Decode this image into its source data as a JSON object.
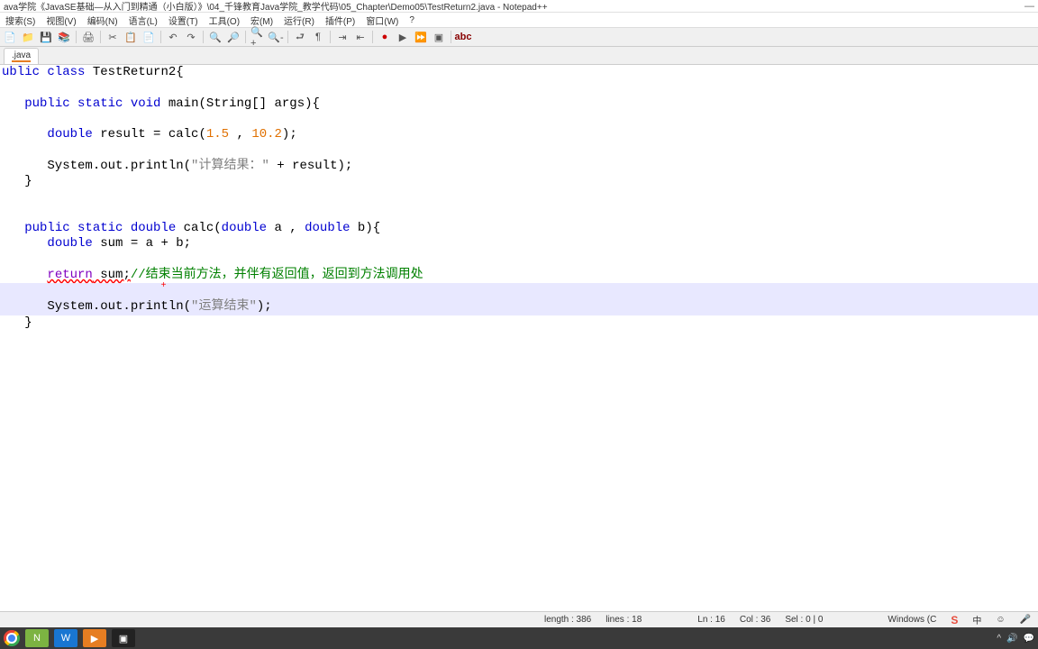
{
  "window": {
    "title": "ava学院《JavaSE基础—从入门到精通（小白版）》\\04_千锋教育Java学院_教学代码\\05_Chapter\\Demo05\\TestReturn2.java - Notepad++"
  },
  "menu": {
    "items": [
      "搜索(S)",
      "视图(V)",
      "编码(N)",
      "语言(L)",
      "设置(T)",
      "工具(O)",
      "宏(M)",
      "运行(R)",
      "插件(P)",
      "窗口(W)",
      "?"
    ]
  },
  "tab": {
    "label": ".java"
  },
  "code": {
    "l1_pre": "ublic class ",
    "l1_name": "TestReturn2",
    "l1_brace": "{",
    "l3_mods": "public static void ",
    "l3_main": "main",
    "l3_sig_a": "(String",
    "l3_sig_b": "[] args){",
    "l5_indent": "      ",
    "l5_double": "double",
    "l5_eq": " result = calc(",
    "l5_n1": "1.5",
    "l5_comma": " , ",
    "l5_n2": "10.2",
    "l5_end": ");",
    "l7_indent": "      System.out.println(",
    "l7_str": "\"计算结果：\"",
    "l7_end": " + result);",
    "l8_brace": "   }",
    "l11_mods": "public static double ",
    "l11_name": "calc",
    "l11_sig_a": "(",
    "l11_kw1": "double",
    "l11_mid": " a , ",
    "l11_kw2": "double",
    "l11_end": " b){",
    "l12_indent": "      ",
    "l12_double": "double",
    "l12_rest": " sum = a + b;",
    "l14_indent": "      ",
    "l14_return": "return",
    "l14_sum": " sum;",
    "l14_comment": "//结束当前方法，并伴有返回值，返回到方法调用处",
    "l16_indent": "      System.out.println(",
    "l16_str": "\"运算结束\"",
    "l16_end": ");",
    "l17_brace": "   }",
    "red_plus": "+"
  },
  "status": {
    "length": "length : 386",
    "lines": "lines : 18",
    "ln": "Ln : 16",
    "col": "Col : 36",
    "sel": "Sel : 0 | 0",
    "encoding": "Windows (C",
    "ime": "S",
    "ime2": "中"
  }
}
